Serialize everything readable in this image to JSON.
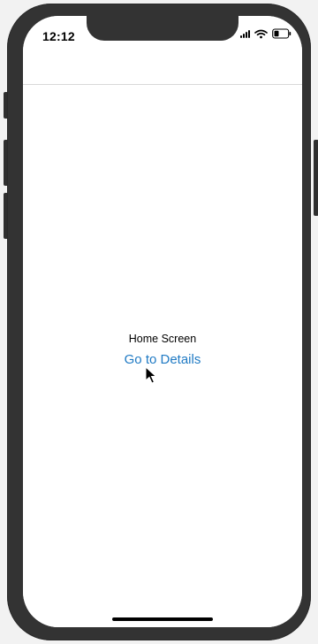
{
  "status_bar": {
    "time": "12:12",
    "icons": [
      "signal-icon",
      "wifi-icon",
      "battery-icon"
    ]
  },
  "screen": {
    "title": "Home Screen",
    "button_label": "Go to Details"
  },
  "colors": {
    "link": "#1f7ac4",
    "frame": "#333333",
    "screen_background": "#ffffff"
  }
}
